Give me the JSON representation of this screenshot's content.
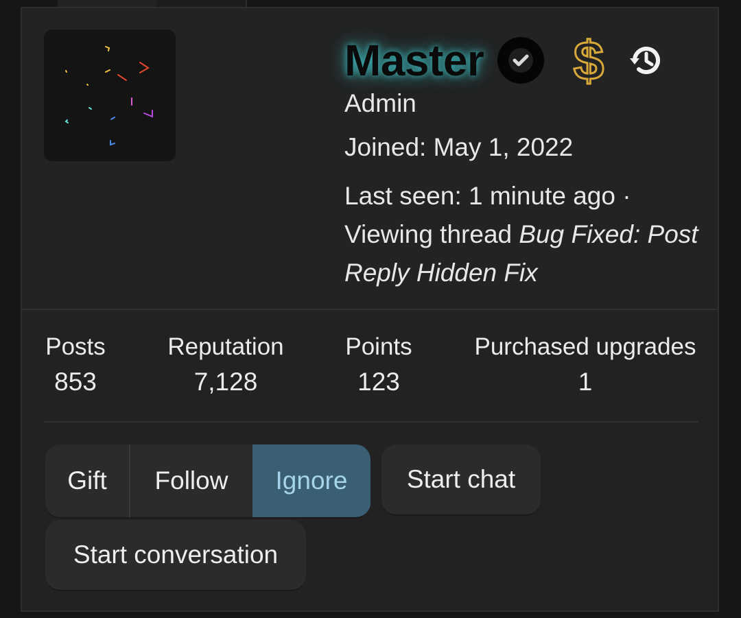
{
  "profile": {
    "username": "Master",
    "user_title": "Admin",
    "joined": "Joined: May 1, 2022",
    "last_seen_prefix": "Last seen: 1 minute ago · Viewing thread ",
    "last_seen_thread": "Bug Fixed: Post Reply Hidden Fix",
    "name_glow_color": "#40c4c8",
    "badges": [
      "verified-check-icon",
      "dollar-sign-icon",
      "history-icon"
    ]
  },
  "stats": [
    {
      "label": "Posts",
      "value": "853"
    },
    {
      "label": "Reputation",
      "value": "7,128"
    },
    {
      "label": "Points",
      "value": "123"
    },
    {
      "label": "Purchased upgrades",
      "value": "1"
    }
  ],
  "actions": {
    "gift": "Gift",
    "follow": "Follow",
    "ignore": "Ignore",
    "start_chat": "Start chat",
    "start_conversation": "Start conversation",
    "active_color": "#3a5f73"
  }
}
